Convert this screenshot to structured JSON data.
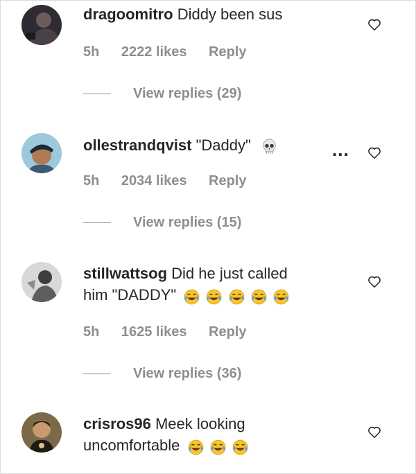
{
  "comments": [
    {
      "username": "dragoomitro",
      "text": "Diddy been sus",
      "text_line2": "",
      "emoji_count": 0,
      "time": "5h",
      "likes": "2222 likes",
      "reply_label": "Reply",
      "view_replies": "View replies (29)",
      "avatar_color": "#2f2b33",
      "has_more_menu": false
    },
    {
      "username": "ollestrandqvist",
      "text": "\"Daddy\"",
      "text_line2": "",
      "emoji_count": 0,
      "time": "5h",
      "likes": "2034 likes",
      "reply_label": "Reply",
      "view_replies": "View replies (15)",
      "avatar_color": "#7fb3c9",
      "has_more_menu": true,
      "trailing_icon": "skull-emoji"
    },
    {
      "username": "stillwattsog",
      "text": "Did he just called",
      "text_line2": "him \"DADDY\"",
      "emoji_count": 5,
      "emoji": "face-with-tears-of-joy",
      "time": "5h",
      "likes": "1625 likes",
      "reply_label": "Reply",
      "view_replies": "View replies (36)",
      "avatar_color": "#9a9a9a",
      "has_more_menu": false
    },
    {
      "username": "crisros96",
      "text": "Meek looking",
      "text_line2": "uncomfortable",
      "emoji_count": 3,
      "emoji": "face-with-tears-of-joy",
      "avatar_color": "#5a4a2e",
      "has_more_menu": false
    }
  ],
  "more_menu_label": "...",
  "colors": {
    "text": "#262626",
    "secondary": "#8e8e8e",
    "emoji_face": "#f5c52d",
    "emoji_tears": "#4fa3e8"
  }
}
